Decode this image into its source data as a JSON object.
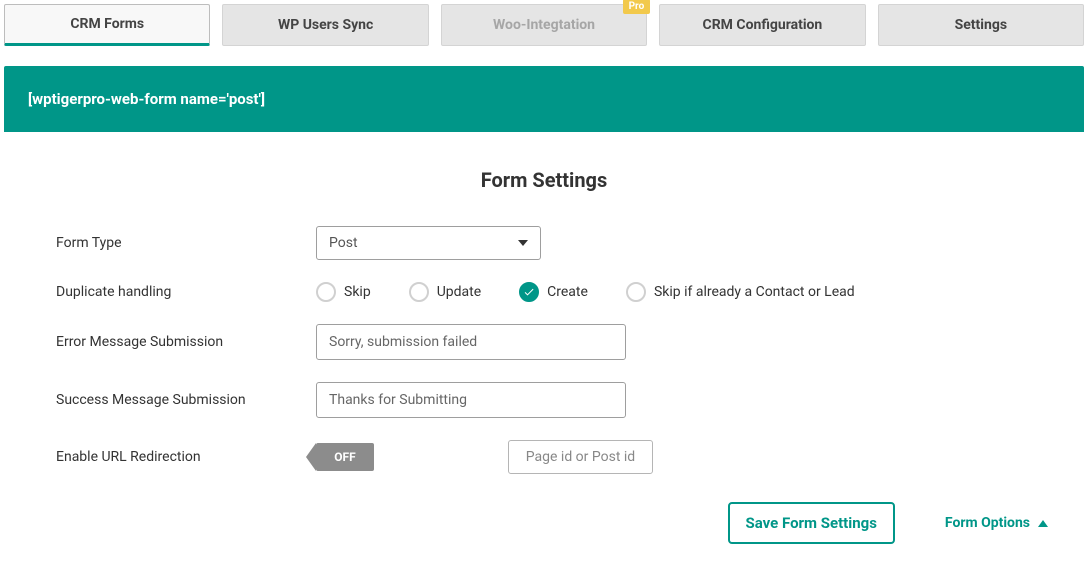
{
  "tabs": [
    {
      "label": "CRM Forms",
      "active": true
    },
    {
      "label": "WP Users Sync"
    },
    {
      "label": "Woo-Integtation",
      "disabled": true,
      "badge": "Pro"
    },
    {
      "label": "CRM Configuration"
    },
    {
      "label": "Settings"
    }
  ],
  "banner": {
    "shortcode": "[wptigerpro-web-form name='post']"
  },
  "section": {
    "title": "Form Settings"
  },
  "labels": {
    "form_type": "Form Type",
    "duplicate": "Duplicate handling",
    "error_msg": "Error Message Submission",
    "success_msg": "Success Message Submission",
    "redirect": "Enable URL Redirection"
  },
  "form_type": {
    "selected": "Post"
  },
  "duplicate_options": {
    "skip": "Skip",
    "update": "Update",
    "create": "Create",
    "skip_contact_lead": "Skip if already a Contact or Lead",
    "selected": "create"
  },
  "error_message": {
    "value": "Sorry, submission failed"
  },
  "success_message": {
    "value": "Thanks for Submitting"
  },
  "redirect": {
    "toggle": "OFF",
    "placeholder": "Page id or Post id"
  },
  "footer": {
    "save": "Save Form Settings",
    "options": "Form Options"
  }
}
